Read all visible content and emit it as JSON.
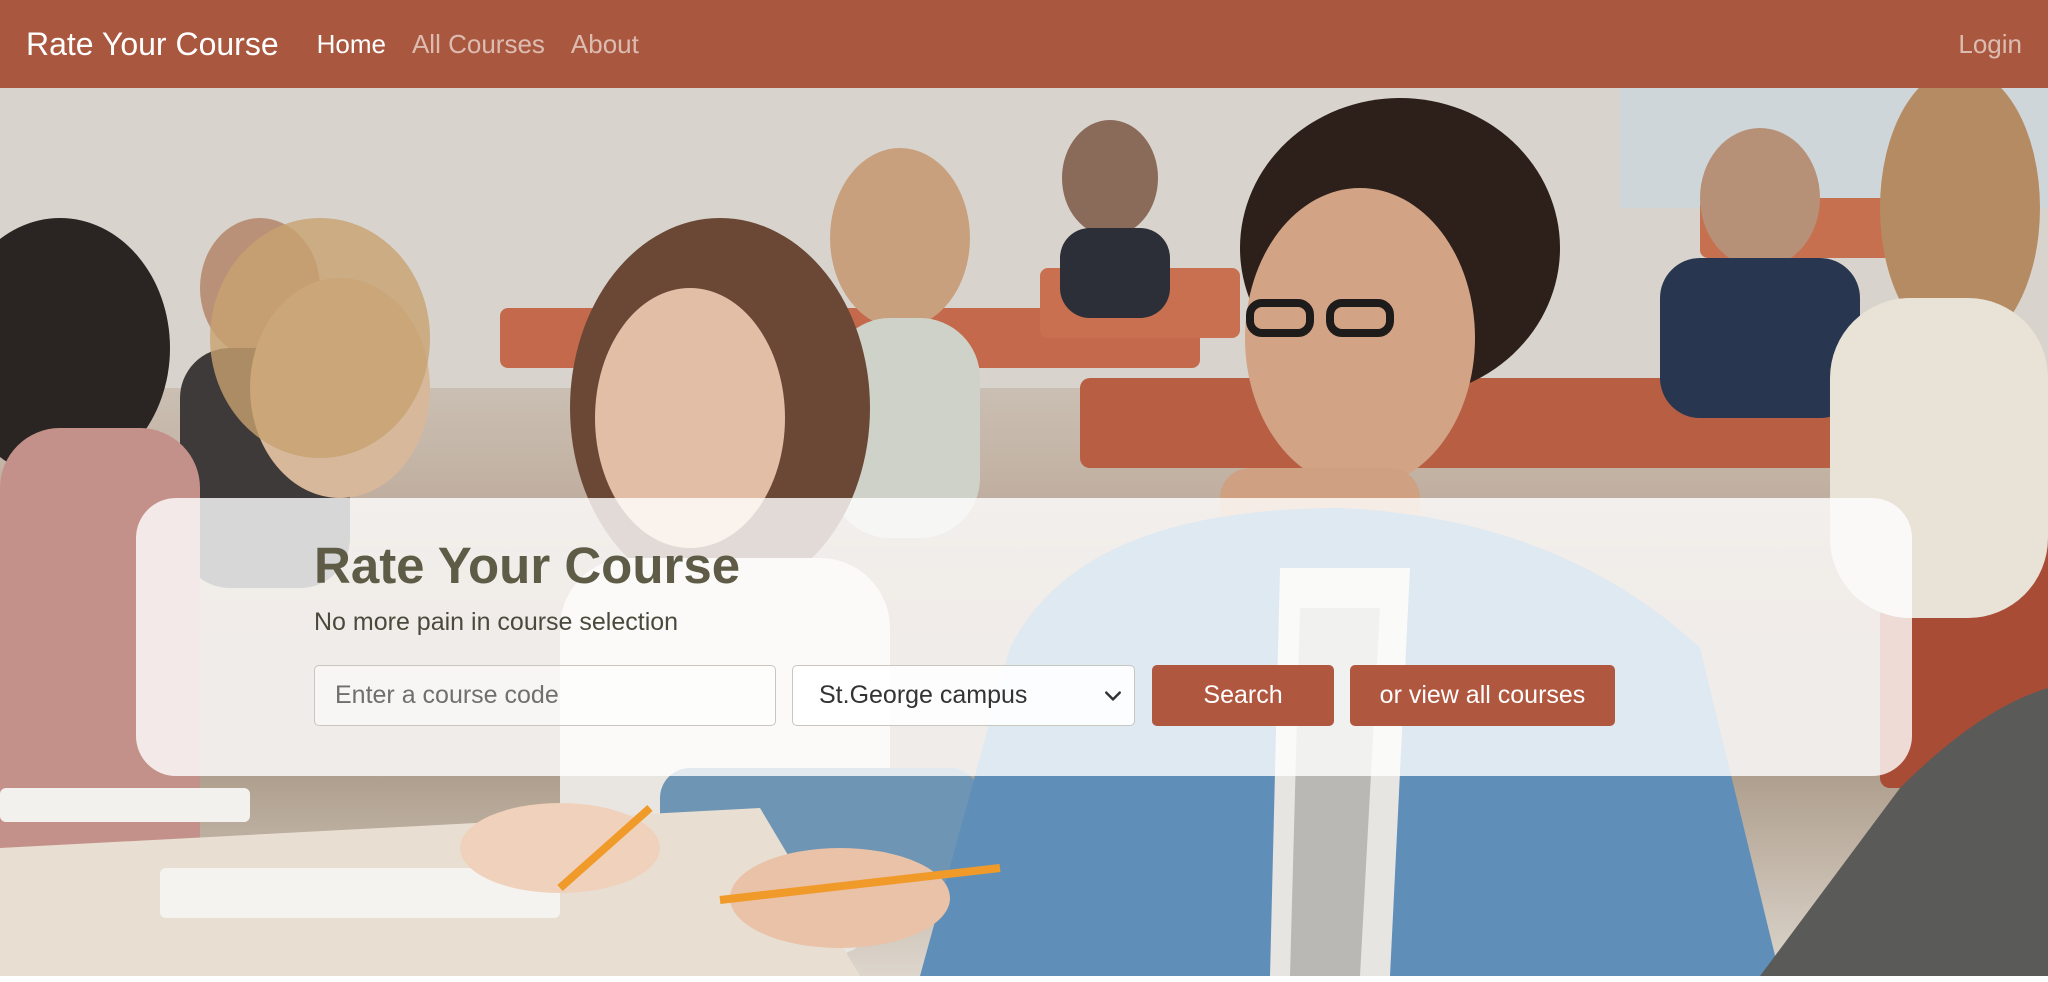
{
  "navbar": {
    "brand": "Rate Your Course",
    "links": [
      {
        "label": "Home",
        "active": true
      },
      {
        "label": "All Courses",
        "active": false
      },
      {
        "label": "About",
        "active": false
      }
    ],
    "login": "Login"
  },
  "hero": {
    "title": "Rate Your Course",
    "subtitle": "No more pain in course selection",
    "search": {
      "placeholder": "Enter a course code",
      "value": ""
    },
    "campus_select": {
      "selected": "St.George campus",
      "icon": "chevron-down-icon"
    },
    "search_button": "Search",
    "view_all_button": "or view all courses"
  },
  "colors": {
    "navbar": "#a9573e",
    "button": "#b0573f",
    "title": "#5e5c46"
  }
}
